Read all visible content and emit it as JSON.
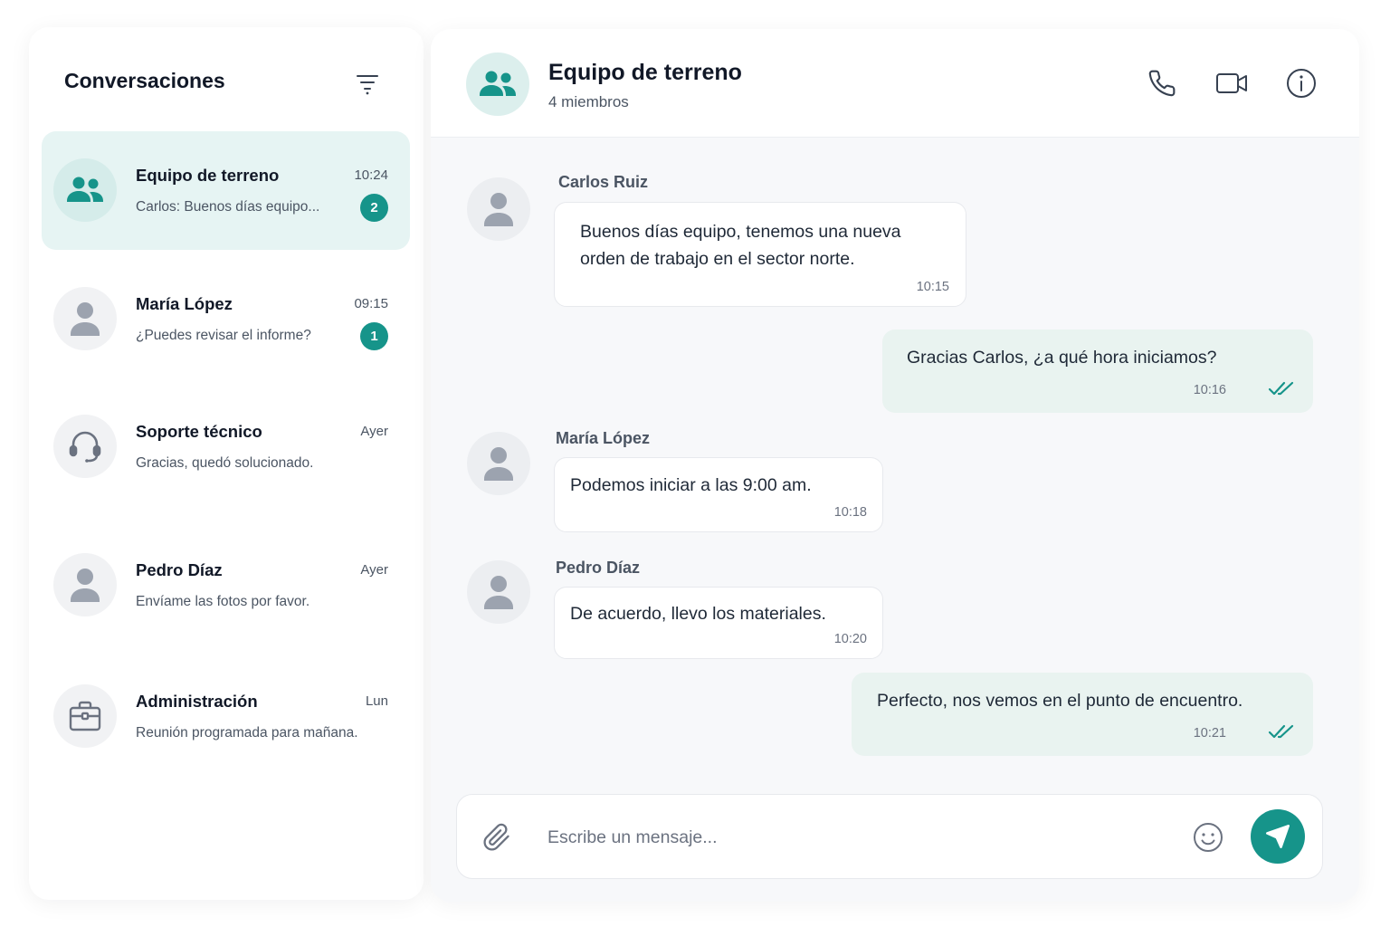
{
  "sidebar": {
    "title": "Conversaciones",
    "conversations": [
      {
        "name": "Equipo de terreno",
        "time": "10:24",
        "preview": "Carlos: Buenos días equipo...",
        "badge": "2",
        "icon": "group-icon",
        "active": true
      },
      {
        "name": "María López",
        "time": "09:15",
        "preview": "¿Puedes revisar el informe?",
        "badge": "1",
        "icon": "user-icon"
      },
      {
        "name": "Soporte técnico",
        "time": "Ayer",
        "preview": "Gracias, quedó solucionado.",
        "icon": "headset-icon"
      },
      {
        "name": "Pedro Díaz",
        "time": "Ayer",
        "preview": "Envíame las fotos por favor.",
        "icon": "user-icon"
      },
      {
        "name": "Administración",
        "time": "Lun",
        "preview": "Reunión programada para mañana.",
        "icon": "briefcase-icon"
      }
    ]
  },
  "chat": {
    "title": "Equipo de terreno",
    "subtitle": "4 miembros",
    "messages": [
      {
        "sender": "Carlos Ruiz",
        "text_lines": [
          "Buenos días equipo, tenemos una nueva",
          "orden de trabajo en el sector norte."
        ],
        "time": "10:15",
        "direction": "in"
      },
      {
        "text_lines": [
          "Gracias Carlos, ¿a qué hora iniciamos?"
        ],
        "time": "10:16",
        "direction": "out",
        "status": "read"
      },
      {
        "sender": "María López",
        "text_lines": [
          "Podemos iniciar a las 9:00 am."
        ],
        "time": "10:18",
        "direction": "in"
      },
      {
        "sender": "Pedro Díaz",
        "text_lines": [
          "De acuerdo, llevo los materiales."
        ],
        "time": "10:20",
        "direction": "in"
      },
      {
        "text_lines": [
          "Perfecto, nos vemos en el punto de encuentro."
        ],
        "time": "10:21",
        "direction": "out",
        "status": "read"
      }
    ]
  },
  "composer": {
    "placeholder": "Escribe un mensaje...",
    "value": ""
  },
  "colors": {
    "accent": "#16948a",
    "active_item_bg": "#e6f4f3",
    "outgoing_bubble_bg": "#e9f3f0",
    "chat_bg": "#f7f8fa"
  },
  "icons": [
    "filter-icon",
    "phone-icon",
    "video-icon",
    "info-icon",
    "paperclip-icon",
    "emoji-icon",
    "send-icon",
    "double-check-icon"
  ]
}
